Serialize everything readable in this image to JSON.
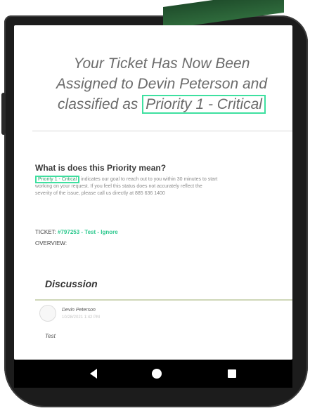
{
  "header": {
    "title_line1": "Your Ticket Has Now Been",
    "title_line2": "Assigned to Devin Peterson and",
    "title_line3_prefix": "classified as ",
    "priority_label": "Priority 1 - Critical"
  },
  "priority_info": {
    "question": "What is does this Priority mean?",
    "priority_tag": "Priority 1 - Critical",
    "line1": " indicates our goal to reach out to you within 30 minutes to start",
    "line2": "working on your request. If you feel this status does not accurately reflect the",
    "line3": "severity of the issue, please call us directly at 885 636 1400"
  },
  "ticket": {
    "label": "TICKET: ",
    "link": "#797253 - Test - Ignore",
    "overview_label": "OVERVIEW:"
  },
  "discussion": {
    "title": "Discussion",
    "author": "Devin Peterson",
    "timestamp": "10/28/2021 1:42 PM",
    "comment": "Test"
  },
  "navbar": {
    "back_icon": "triangle-back",
    "home_icon": "circle-home",
    "recent_icon": "square-recent"
  },
  "colors": {
    "highlight": "#3ee0a0",
    "link": "#2ec98f",
    "banner": "#2f6b3c"
  }
}
